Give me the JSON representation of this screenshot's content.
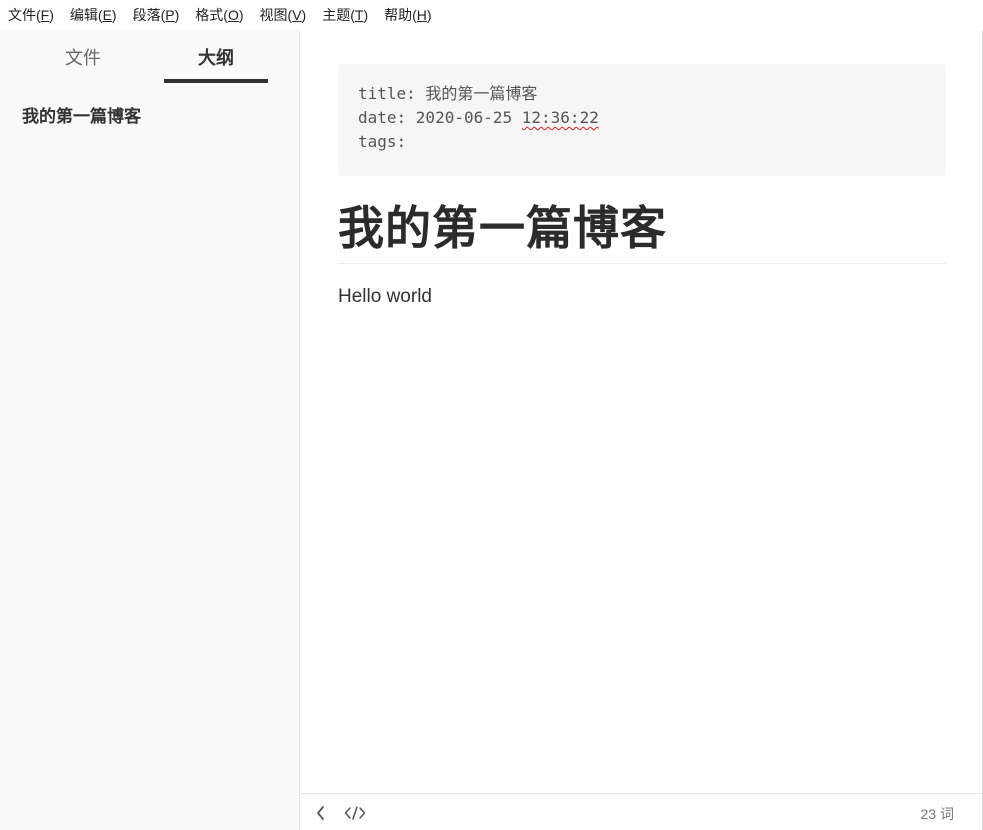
{
  "menubar": {
    "items": [
      {
        "label": "文件(",
        "key": "F",
        "close": ")"
      },
      {
        "label": "编辑(",
        "key": "E",
        "close": ")"
      },
      {
        "label": "段落(",
        "key": "P",
        "close": ")"
      },
      {
        "label": "格式(",
        "key": "O",
        "close": ")"
      },
      {
        "label": "视图(",
        "key": "V",
        "close": ")"
      },
      {
        "label": "主题(",
        "key": "T",
        "close": ")"
      },
      {
        "label": "帮助(",
        "key": "H",
        "close": ")"
      }
    ]
  },
  "sidebar": {
    "tabs": {
      "files": "文件",
      "outline": "大纲"
    },
    "active_tab": "outline",
    "outline_items": [
      "我的第一篇博客"
    ]
  },
  "document": {
    "front_matter": {
      "line1": "title: 我的第一篇博客",
      "line2_prefix": "date: 2020-06-25 ",
      "line2_time": "12:36:22",
      "line3": "tags:"
    },
    "heading": "我的第一篇博客",
    "paragraph": "Hello world"
  },
  "statusbar": {
    "back_icon": "chevron-left-icon",
    "source_icon": "code-icon",
    "word_count": "23 词"
  }
}
